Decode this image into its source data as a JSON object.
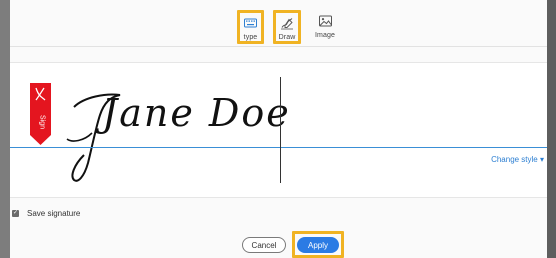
{
  "modes": {
    "type_label": "type",
    "draw_label": "Draw",
    "image_label": "Image"
  },
  "signature": {
    "text": "Jane Doe",
    "ribbon_label": "Sign",
    "change_style_label": "Change style ▾"
  },
  "save": {
    "label": "Save signature",
    "checked": true
  },
  "actions": {
    "cancel_label": "Cancel",
    "apply_label": "Apply"
  },
  "colors": {
    "accent": "#2b7be4",
    "highlight": "#f0b323",
    "ribbon": "#e4151f",
    "baseline": "#3a8fd6"
  }
}
